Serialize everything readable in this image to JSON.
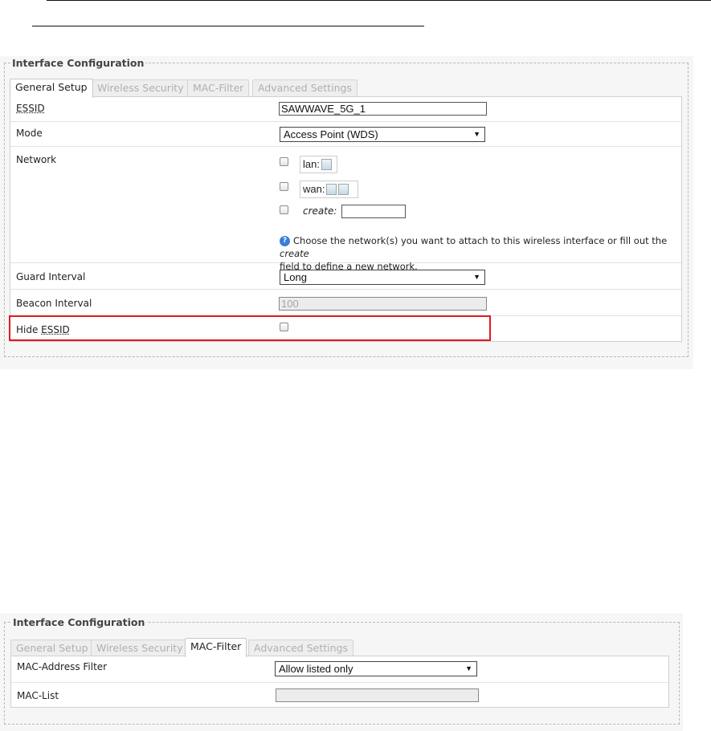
{
  "top_panel": {
    "legend": "Interface Configuration",
    "tabs": [
      {
        "label": "General Setup",
        "active": true
      },
      {
        "label": "Wireless Security",
        "active": false
      },
      {
        "label": "MAC-Filter",
        "active": false
      },
      {
        "label": "Advanced Settings",
        "active": false
      }
    ],
    "essid_label": "ESSID",
    "essid_value": "SAWWAVE_5G_1",
    "mode_label": "Mode",
    "mode_value": "Access Point (WDS)",
    "network_label": "Network",
    "networks": [
      {
        "name": "lan:",
        "icon": "network-icon"
      },
      {
        "name": "wan:",
        "icon": "network-icon"
      }
    ],
    "create_label": "create:",
    "hint_text_1": "Choose the network(s) you want to attach to this wireless interface or fill out the ",
    "hint_text_em": "create",
    "hint_text_2": "field to define a new network.",
    "guard_label": "Guard Interval",
    "guard_value": "Long",
    "beacon_label": "Beacon Interval",
    "beacon_placeholder": "100",
    "hide_label_prefix": "Hide ",
    "hide_label_essid": "ESSID",
    "highlight_color": "#e0191f"
  },
  "bottom_panel": {
    "legend": "Interface Configuration",
    "tabs": [
      {
        "label": "General Setup",
        "active": false
      },
      {
        "label": "Wireless Security",
        "active": false
      },
      {
        "label": "MAC-Filter",
        "active": true
      },
      {
        "label": "Advanced Settings",
        "active": false
      }
    ],
    "mac_filter_label": "MAC-Address Filter",
    "mac_filter_value": "Allow listed only",
    "mac_list_label": "MAC-List",
    "mac_list_value": ""
  }
}
